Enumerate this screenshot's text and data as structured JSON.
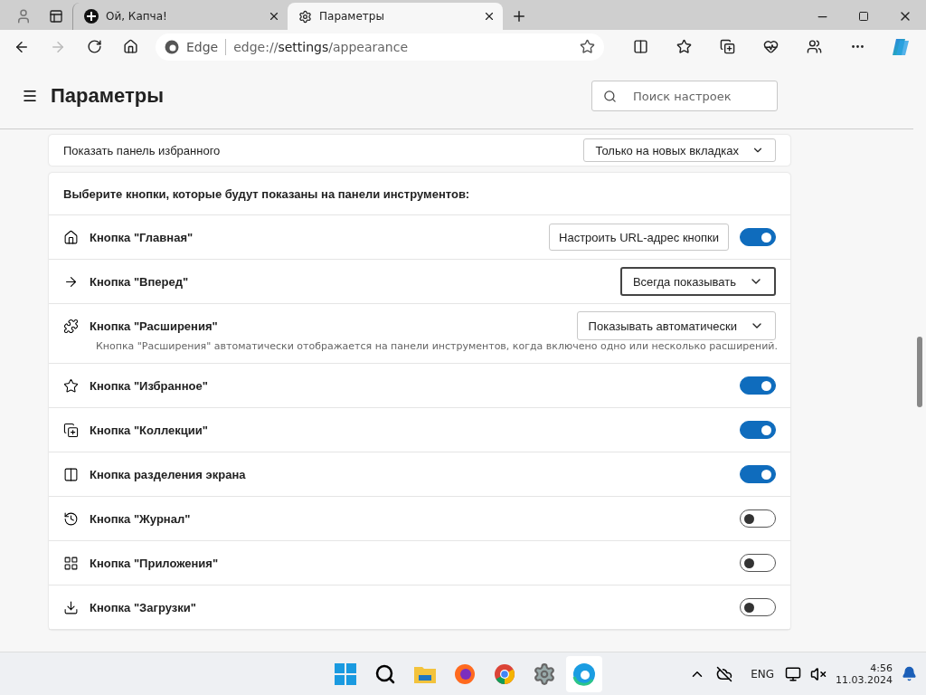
{
  "tabs": [
    {
      "title": "Ой, Капча!",
      "selected": false
    },
    {
      "title": "Параметры",
      "selected": true
    }
  ],
  "address_bar": {
    "site_label": "Edge",
    "url_prefix": "edge://",
    "url_main": "settings",
    "url_suffix": "/appearance"
  },
  "header": {
    "title": "Параметры",
    "search": {
      "placeholder": "Поиск настроек"
    }
  },
  "favorites_bar_row": {
    "label": "Показать панель избранного",
    "value": "Только на новых вкладках"
  },
  "toolbar_section": {
    "heading": "Выберите кнопки, которые будут показаны на панели инструментов:",
    "rows": [
      {
        "kind": "toggle",
        "label": "Кнопка \"Главная\"",
        "button": "Настроить URL-адрес кнопки",
        "on": true
      },
      {
        "kind": "dropdown",
        "label": "Кнопка \"Вперед\"",
        "value": "Всегда показывать",
        "focused": true
      },
      {
        "kind": "dropdown",
        "label": "Кнопка \"Расширения\"",
        "value": "Показывать автоматически",
        "focused": false,
        "description": "Кнопка \"Расширения\" автоматически отображается на панели инструментов, когда включено одно или несколько расширений."
      },
      {
        "kind": "toggle",
        "label": "Кнопка \"Избранное\"",
        "on": true
      },
      {
        "kind": "toggle",
        "label": "Кнопка \"Коллекции\"",
        "on": true
      },
      {
        "kind": "toggle",
        "label": "Кнопка разделения экрана",
        "on": true
      },
      {
        "kind": "toggle",
        "label": "Кнопка \"Журнал\"",
        "on": false
      },
      {
        "kind": "toggle",
        "label": "Кнопка \"Приложения\"",
        "on": false
      },
      {
        "kind": "toggle",
        "label": "Кнопка \"Загрузки\"",
        "on": false
      }
    ]
  },
  "taskbar": {
    "language": "ENG",
    "time": "4:56",
    "date": "11.03.2024"
  }
}
